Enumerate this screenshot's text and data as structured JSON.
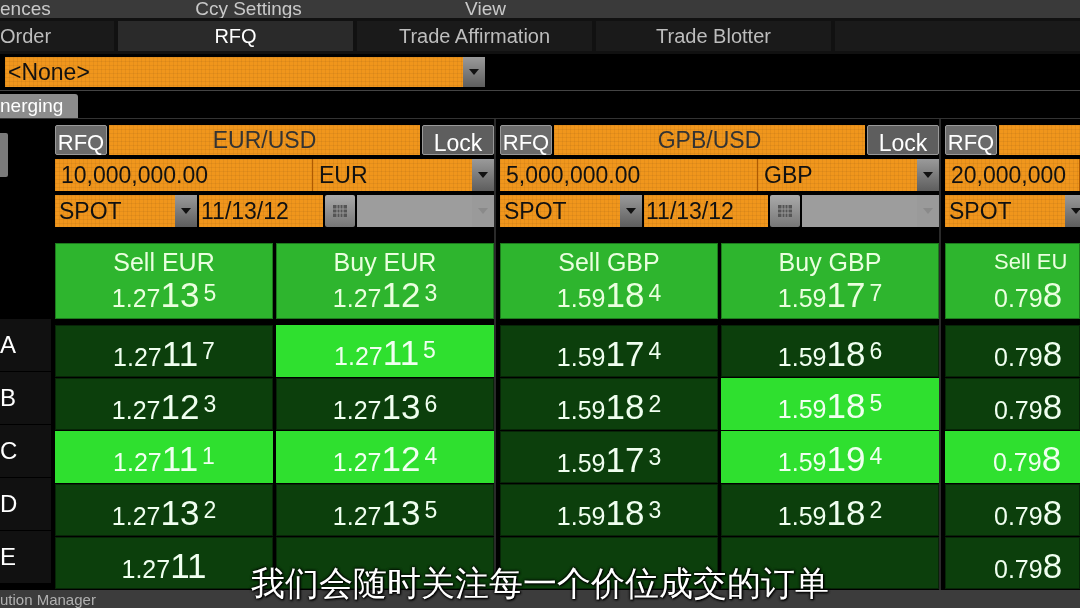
{
  "menu_bar": [
    "ences",
    "Ccy Settings",
    "View"
  ],
  "tabs": [
    {
      "label": "Order",
      "selected": false
    },
    {
      "label": "RFQ",
      "selected": true
    },
    {
      "label": "Trade Affirmation",
      "selected": false
    },
    {
      "label": "Trade Blotter",
      "selected": false
    },
    {
      "selected": false
    }
  ],
  "profile_dropdown": {
    "value": "<None>"
  },
  "group_tab": {
    "label": "nerging"
  },
  "row_labels": [
    "A",
    "B",
    "C",
    "D",
    "E"
  ],
  "panels": [
    {
      "rfq": "RFQ",
      "pair": "EUR/USD",
      "lock": "Lock",
      "amount": "10,000,000.00",
      "currency": "EUR",
      "tenor": "SPOT",
      "date": "11/13/12",
      "columns": [
        {
          "label": "Sell EUR",
          "pre": "1.27",
          "big": "13",
          "pip": "5",
          "quotes": [
            {
              "pre": "1.27",
              "big": "11",
              "pip": "7",
              "highlighted": false
            },
            {
              "pre": "1.27",
              "big": "12",
              "pip": "3",
              "highlighted": false
            },
            {
              "pre": "1.27",
              "big": "11",
              "pip": "1",
              "highlighted": true
            },
            {
              "pre": "1.27",
              "big": "13",
              "pip": "2",
              "highlighted": false
            },
            {
              "pre": "1.27",
              "big": "11",
              "highlighted": false
            }
          ]
        },
        {
          "label": "Buy EUR",
          "pre": "1.27",
          "big": "12",
          "pip": "3",
          "quotes": [
            {
              "pre": "1.27",
              "big": "11",
              "pip": "5",
              "highlighted": true
            },
            {
              "pre": "1.27",
              "big": "13",
              "pip": "6",
              "highlighted": false
            },
            {
              "pre": "1.27",
              "big": "12",
              "pip": "4",
              "highlighted": true
            },
            {
              "pre": "1.27",
              "big": "13",
              "pip": "5",
              "highlighted": false
            },
            {
              "highlighted": false
            }
          ]
        }
      ]
    },
    {
      "rfq": "RFQ",
      "pair": "GPB/USD",
      "lock": "Lock",
      "amount": "5,000,000.00",
      "currency": "GBP",
      "tenor": "SPOT",
      "date": "11/13/12",
      "columns": [
        {
          "label": "Sell GBP",
          "pre": "1.59",
          "big": "18",
          "pip": "4",
          "quotes": [
            {
              "pre": "1.59",
              "big": "17",
              "pip": "4",
              "highlighted": false
            },
            {
              "pre": "1.59",
              "big": "18",
              "pip": "2",
              "highlighted": false
            },
            {
              "pre": "1.59",
              "big": "17",
              "pip": "3",
              "highlighted": false
            },
            {
              "pre": "1.59",
              "big": "18",
              "pip": "3",
              "highlighted": false
            },
            {
              "highlighted": false
            }
          ]
        },
        {
          "label": "Buy GBP",
          "pre": "1.59",
          "big": "17",
          "pip": "7",
          "quotes": [
            {
              "pre": "1.59",
              "big": "18",
              "pip": "6",
              "highlighted": false
            },
            {
              "pre": "1.59",
              "big": "18",
              "pip": "5",
              "highlighted": true
            },
            {
              "pre": "1.59",
              "big": "19",
              "pip": "4",
              "highlighted": true
            },
            {
              "pre": "1.59",
              "big": "18",
              "pip": "2",
              "highlighted": false
            },
            {
              "highlighted": false
            }
          ]
        }
      ]
    },
    {
      "rfq": "RFQ",
      "amount": "20,000,000",
      "tenor": "SPOT",
      "columns": [
        {
          "label": "Sell EU",
          "pre": "0.79",
          "big": "8",
          "quotes": [
            {
              "pre": "0.79",
              "big": "8",
              "highlighted": false
            },
            {
              "pre": "0.79",
              "big": "8",
              "highlighted": false
            },
            {
              "pre": "0.79",
              "big": "8",
              "highlighted": true
            },
            {
              "pre": "0.79",
              "big": "8",
              "highlighted": false
            },
            {
              "pre": "0.79",
              "big": "8",
              "highlighted": false
            }
          ]
        }
      ]
    }
  ],
  "status_bar": {
    "label": "ution Manager"
  },
  "subtitle": "我们会随时关注每一个价位成交的订单"
}
